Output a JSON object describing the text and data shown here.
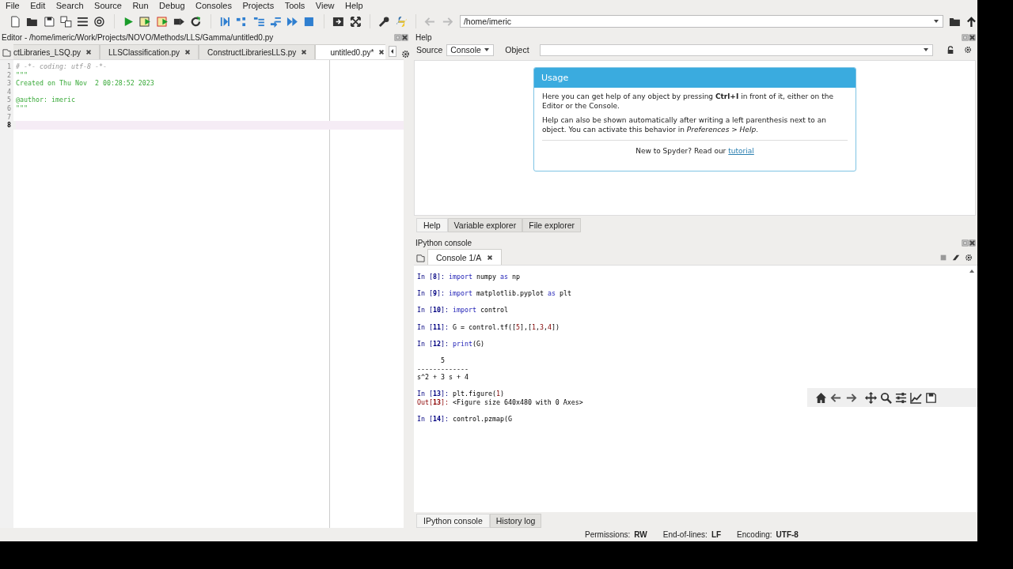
{
  "menu": [
    "File",
    "Edit",
    "Search",
    "Source",
    "Run",
    "Debug",
    "Consoles",
    "Projects",
    "Tools",
    "View",
    "Help"
  ],
  "toolbar": {
    "path": "/home/imeric"
  },
  "editor": {
    "title": "Editor - /home/imeric/Work/Projects/NOVO/Methods/LLS/Gamma/untitled0.py",
    "tabs": [
      {
        "label": "ctLibraries_LSQ.py",
        "selected": false
      },
      {
        "label": "LLSClassification.py",
        "selected": false
      },
      {
        "label": "ConstructLibrariesLLS.py",
        "selected": false
      },
      {
        "label": "untitled0.py*",
        "selected": true
      }
    ],
    "lines": [
      {
        "number": "1",
        "kind": "comment",
        "text": "# -*- coding: utf-8 -*-",
        "selected": false
      },
      {
        "number": "2",
        "kind": "docstring",
        "text": "\"\"\"",
        "selected": false
      },
      {
        "number": "3",
        "kind": "docstring",
        "text": "Created on Thu Nov  2 00:28:52 2023",
        "selected": false
      },
      {
        "number": "4",
        "kind": "blank",
        "selected": false
      },
      {
        "number": "5",
        "kind": "docstring",
        "text": "@author: imeric",
        "selected": false
      },
      {
        "number": "6",
        "kind": "docstring",
        "text": "\"\"\"",
        "selected": false
      },
      {
        "number": "7",
        "kind": "blank",
        "selected": false
      },
      {
        "number": "8",
        "kind": "blank",
        "selected": true
      }
    ]
  },
  "help": {
    "title": "Help",
    "source_label": "Source",
    "source_value": "Console",
    "object_label": "Object",
    "usage": {
      "title": "Usage",
      "paragraphs": [
        "Here you can get help of any object by pressing **Ctrl+I** in front of it, either on the Editor or the Console.",
        "Help can also be shown automatically after writing a left parenthesis next to an object. You can activate this behavior in *Preferences > Help*."
      ],
      "footer": "New to Spyder? Read our",
      "link": "tutorial"
    },
    "tabs": [
      {
        "label": "Help",
        "selected": true
      },
      {
        "label": "Variable explorer",
        "selected": false
      },
      {
        "label": "File explorer",
        "selected": false
      }
    ]
  },
  "console": {
    "title": "IPython console",
    "tab": "Console 1/A",
    "entries": [
      {
        "prompt": "In [**8**]:",
        "code": [
          {
            "kind": "keyword",
            "text": "import"
          },
          {
            "kind": "plain",
            "text": " numpy "
          },
          {
            "kind": "keyword",
            "text": "as"
          },
          {
            "kind": "plain",
            "text": " np"
          }
        ]
      },
      {
        "prompt": "In [**9**]:",
        "code": [
          {
            "kind": "keyword",
            "text": "import"
          },
          {
            "kind": "plain",
            "text": " matplotlib.pyplot "
          },
          {
            "kind": "keyword",
            "text": "as"
          },
          {
            "kind": "plain",
            "text": " plt"
          }
        ]
      },
      {
        "prompt": "In [**10**]:",
        "code": [
          {
            "kind": "keyword",
            "text": "import"
          },
          {
            "kind": "plain",
            "text": " control"
          }
        ]
      },
      {
        "prompt": "In [**11**]:",
        "code": [
          {
            "kind": "plain",
            "text": "G = control.tf(["
          },
          {
            "kind": "number",
            "text": "5"
          },
          {
            "kind": "plain",
            "text": "],["
          },
          {
            "kind": "number",
            "text": "1"
          },
          {
            "kind": "plain",
            "text": ","
          },
          {
            "kind": "number",
            "text": "3"
          },
          {
            "kind": "plain",
            "text": ","
          },
          {
            "kind": "number",
            "text": "4"
          },
          {
            "kind": "plain",
            "text": "])"
          }
        ]
      },
      {
        "prompt": "In [**12**]:",
        "code": [
          {
            "kind": "keyword",
            "text": "print"
          },
          {
            "kind": "plain",
            "text": "(G)"
          }
        ],
        "printed": [
          "      5",
          "-------------",
          "s^2 + 3 s + 4"
        ]
      },
      {
        "prompt": "In [**13**]:",
        "code": [
          {
            "kind": "plain",
            "text": "plt.figure("
          },
          {
            "kind": "number",
            "text": "1"
          },
          {
            "kind": "plain",
            "text": ")"
          }
        ],
        "out": {
          "prompt": "Out[**13**]:",
          "text": "<Figure size 640x480 with 0 Axes>"
        }
      },
      {
        "prompt": "In [**14**]:",
        "code": [
          {
            "kind": "plain",
            "text": "control.pzmap(G"
          }
        ]
      }
    ]
  },
  "bottom_tabs": [
    {
      "label": "IPython console",
      "selected": true
    },
    {
      "label": "History log",
      "selected": false
    }
  ],
  "status": [
    {
      "label": "Permissions:",
      "value": "RW"
    },
    {
      "label": "End-of-lines:",
      "value": "LF"
    },
    {
      "label": "Encoding:",
      "value": "UTF-8"
    }
  ]
}
